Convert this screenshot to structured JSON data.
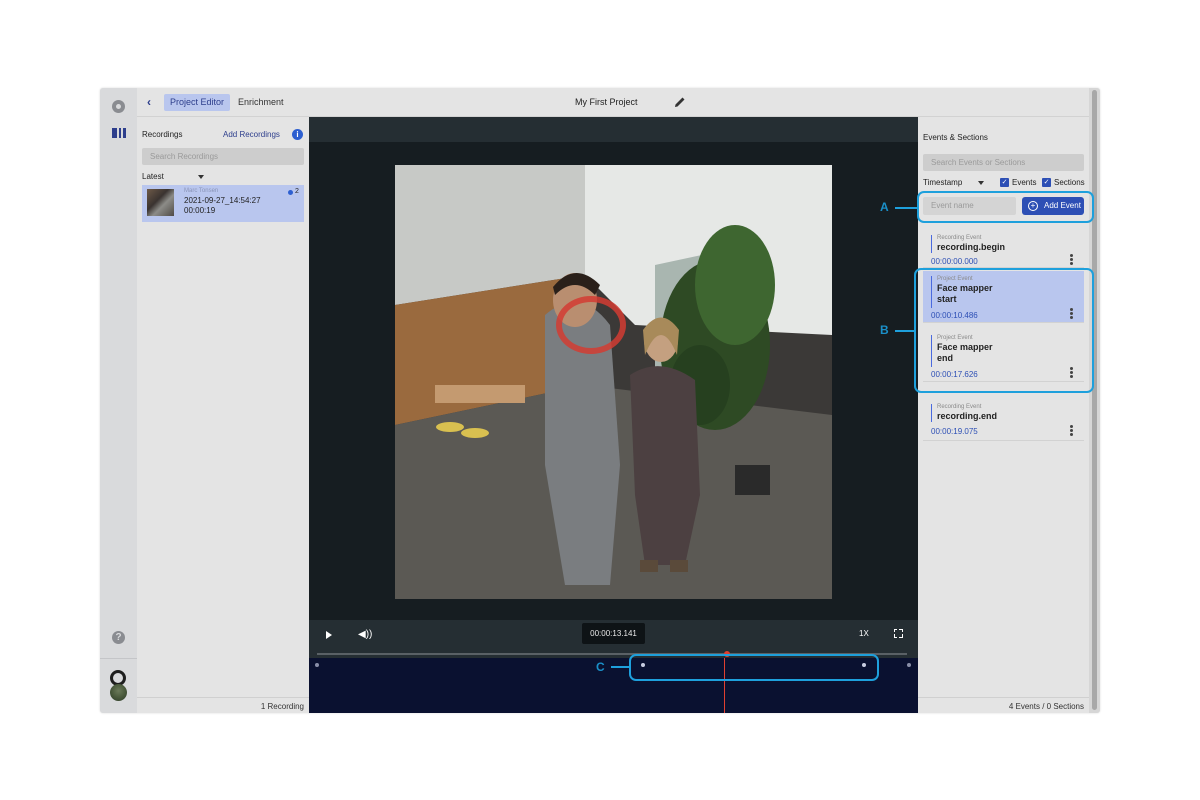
{
  "top_bar": {
    "back_label": "‹",
    "tabs": [
      {
        "label": "Project Editor",
        "active": true
      },
      {
        "label": "Enrichment",
        "active": false
      }
    ],
    "project_title": "My First Project"
  },
  "recordings": {
    "header": "Recordings",
    "add_label": "Add Recordings",
    "search_placeholder": "Search Recordings",
    "sort": "Latest",
    "items": [
      {
        "author": "Marc Tonsen",
        "name": "2021-09-27_14:54:27",
        "duration": "00:00:19",
        "count": "2"
      }
    ],
    "footer": "1 Recording"
  },
  "player": {
    "timecode": "00:00:13.141",
    "speed": "1X",
    "progress": 0.7
  },
  "events_panel": {
    "header": "Events & Sections",
    "search_placeholder": "Search Events or Sections",
    "sort": "Timestamp",
    "filters": [
      {
        "label": "Events",
        "checked": true
      },
      {
        "label": "Sections",
        "checked": true
      }
    ],
    "input_placeholder": "Event name",
    "add_label": "Add Event",
    "items": [
      {
        "type": "Recording Event",
        "name": "recording.begin",
        "time": "00:00:00.000",
        "selected": false
      },
      {
        "type": "Project Event",
        "name": "Face mapper start",
        "time": "00:00:10.486",
        "selected": true
      },
      {
        "type": "Project Event",
        "name": "Face mapper end",
        "time": "00:00:17.626",
        "selected": false
      },
      {
        "type": "Recording Event",
        "name": "recording.end",
        "time": "00:00:19.075",
        "selected": false
      }
    ],
    "footer": "4 Events / 0 Sections"
  },
  "callouts": {
    "a": "A",
    "b": "B",
    "c": "C"
  },
  "colors": {
    "accent": "#2d4fb5",
    "highlight": "#b9c6ee",
    "callout": "#1ea0dc",
    "playhead": "#e04030"
  }
}
